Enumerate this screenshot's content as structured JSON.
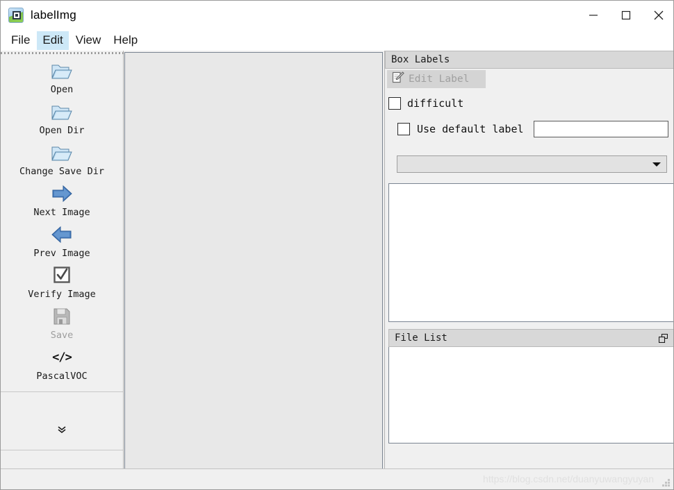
{
  "window": {
    "title": "labelImg",
    "app_icon": "image-label-icon",
    "controls": [
      {
        "name": "minimize",
        "icon": "minimize-icon"
      },
      {
        "name": "maximize",
        "icon": "maximize-icon"
      },
      {
        "name": "close",
        "icon": "close-icon"
      }
    ]
  },
  "menubar": {
    "items": [
      {
        "label": "File",
        "highlighted": false
      },
      {
        "label": "Edit",
        "highlighted": true
      },
      {
        "label": "View",
        "highlighted": false
      },
      {
        "label": "Help",
        "highlighted": false
      }
    ]
  },
  "toolbar": {
    "items": [
      {
        "label": "Open",
        "icon": "open-folder-icon",
        "disabled": false
      },
      {
        "label": "Open Dir",
        "icon": "open-folder-icon",
        "disabled": false
      },
      {
        "label": "Change Save Dir",
        "icon": "open-folder-icon",
        "disabled": false
      },
      {
        "label": "Next Image",
        "icon": "arrow-right-icon",
        "disabled": false
      },
      {
        "label": "Prev Image",
        "icon": "arrow-left-icon",
        "disabled": false
      },
      {
        "label": "Verify Image",
        "icon": "checkbox-tick-icon",
        "disabled": false
      },
      {
        "label": "Save",
        "icon": "floppy-disk-icon",
        "disabled": true
      },
      {
        "label": "PascalVOC",
        "icon": "code-tags-icon",
        "disabled": false
      }
    ],
    "expand_icon": "chevron-double-down-icon"
  },
  "canvas": {
    "name": "image-canvas",
    "background": "#e8e8e8"
  },
  "box_labels": {
    "title": "Box Labels",
    "edit_label_button": {
      "label": "Edit Label",
      "icon": "edit-pencil-icon",
      "disabled": true
    },
    "difficult_checkbox": {
      "label": "difficult",
      "checked": false
    },
    "use_default_label_checkbox": {
      "label": "Use default label",
      "checked": false
    },
    "default_label_input": {
      "value": "",
      "placeholder": ""
    },
    "label_combo": {
      "value": "",
      "icon": "chevron-down-icon",
      "options": []
    },
    "label_list_items": []
  },
  "file_list": {
    "title": "File List",
    "float_icon": "undock-icon",
    "items": []
  },
  "statusbar": {
    "watermark": "https://blog.csdn.net/duanyuwangyuyan",
    "grip_icon": "resize-grip-icon"
  },
  "colors": {
    "window_bg": "#f0f0f0",
    "titlebar_bg": "#ffffff",
    "canvas_bg": "#e8e8e8",
    "dock_title_bg": "#d8d8d8",
    "menu_highlight": "#cde8f7",
    "disabled_text": "#9d9d9d",
    "folder_icon": "#b7dcf2",
    "arrow_icon": "#3a6fb5"
  }
}
